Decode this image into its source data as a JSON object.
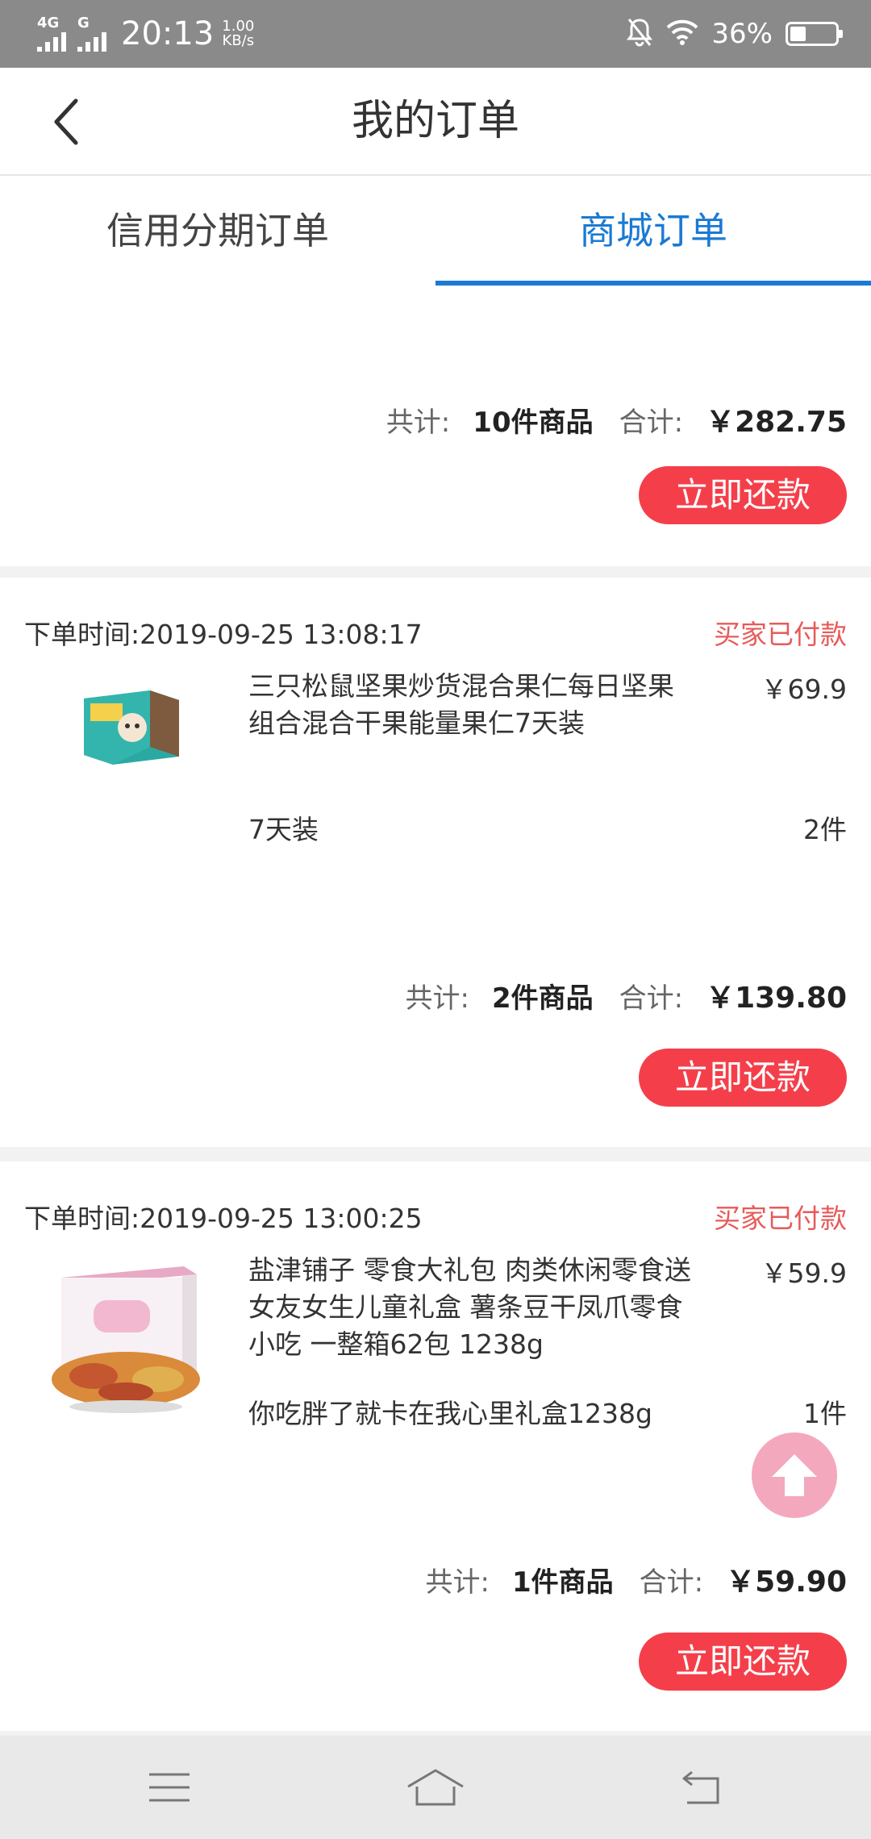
{
  "status_bar": {
    "network1": "4G",
    "network2": "G",
    "time": "20:13",
    "speed_value": "1.00",
    "speed_unit": "KB/s",
    "battery_percent": "36%",
    "battery_level": 0.36
  },
  "header": {
    "title": "我的订单",
    "back_icon": "chevron-left-icon"
  },
  "tabs": [
    {
      "label": "信用分期订单",
      "active": false
    },
    {
      "label": "商城订单",
      "active": true
    }
  ],
  "orders": [
    {
      "count_label": "共计:",
      "count_value": "10件商品",
      "total_label": "合计:",
      "total_value": "￥282.75",
      "button": "立即还款"
    },
    {
      "time": "下单时间:2019-09-25 13:08:17",
      "status": "买家已付款",
      "product_name": "三只松鼠坚果炒货混合果仁每日坚果组合混合干果能量果仁7天装",
      "price": "￥69.9",
      "spec": "7天装",
      "qty": "2件",
      "count_label": "共计:",
      "count_value": "2件商品",
      "total_label": "合计:",
      "total_value": "￥139.80",
      "button": "立即还款"
    },
    {
      "time": "下单时间:2019-09-25 13:00:25",
      "status": "买家已付款",
      "product_name": "盐津铺子 零食大礼包 肉类休闲零食送女友女生儿童礼盒 薯条豆干凤爪零食小吃 一整箱62包 1238g",
      "price": "￥59.9",
      "spec": "你吃胖了就卡在我心里礼盒1238g",
      "qty": "1件",
      "count_label": "共计:",
      "count_value": "1件商品",
      "total_label": "合计:",
      "total_value": "￥59.90",
      "button": "立即还款"
    }
  ],
  "colors": {
    "accent": "#1a7ad4",
    "button_red": "#f43f4a",
    "status_red": "#e85a5a",
    "to_top_pink": "#f4a8bd"
  },
  "floating": {
    "icon": "arrow-up-icon"
  },
  "navbar": {
    "icons": [
      "menu-icon",
      "home-icon",
      "back-icon"
    ]
  }
}
